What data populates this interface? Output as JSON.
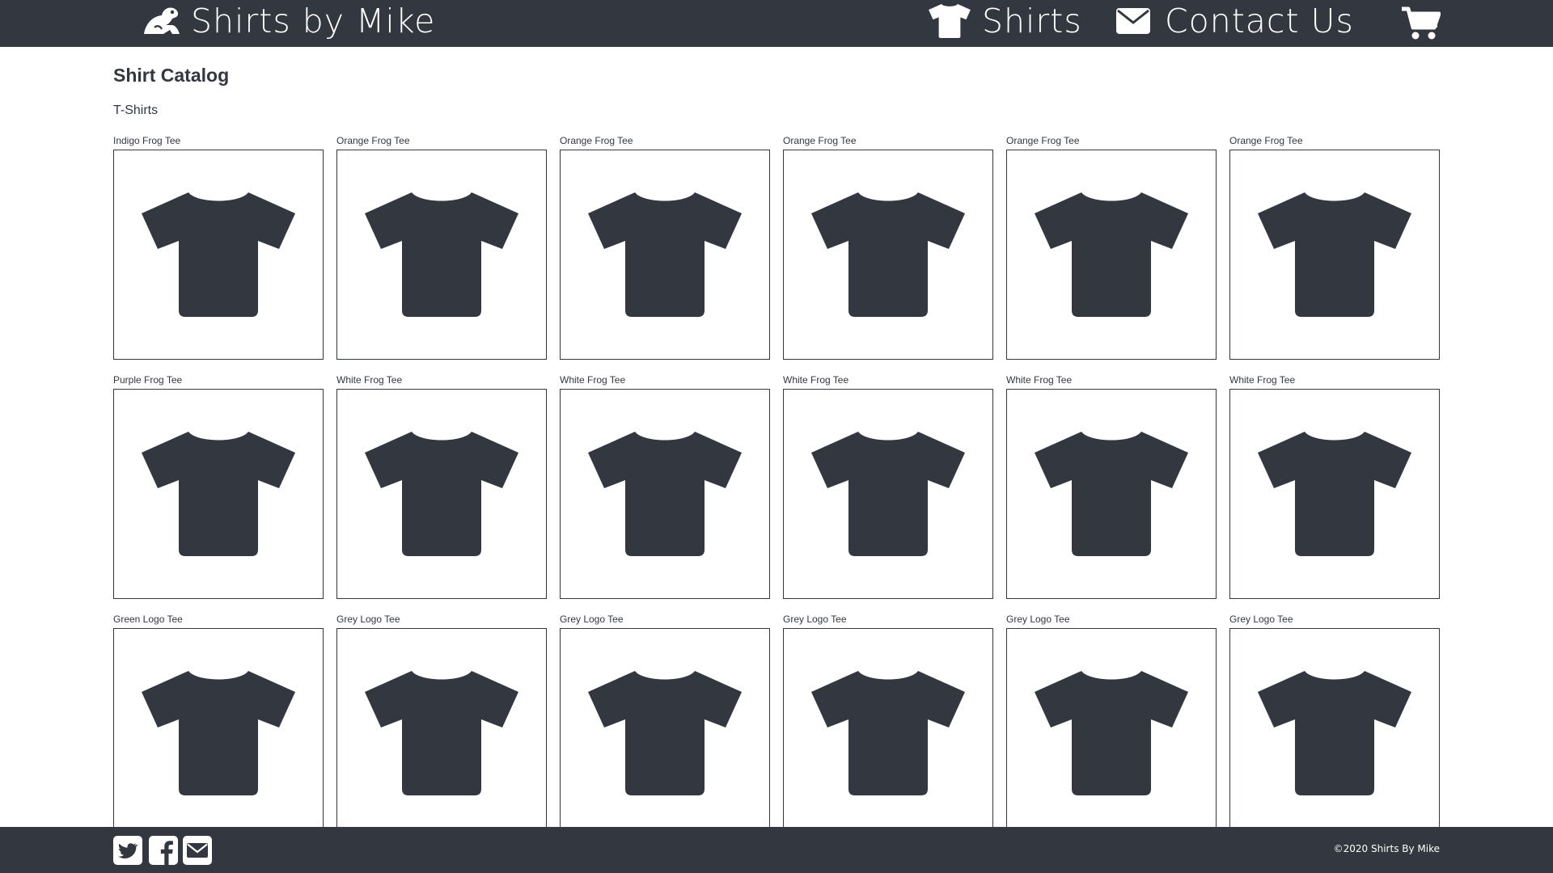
{
  "header": {
    "brand_name": "Shirts by Mike",
    "nav_shirts_label": "Shirts",
    "nav_contact_label": "Contact Us"
  },
  "main": {
    "title": "Shirt Catalog",
    "category": "T-Shirts",
    "products": [
      {
        "name": "Indigo Frog Tee"
      },
      {
        "name": "Orange Frog Tee"
      },
      {
        "name": "Orange Frog Tee"
      },
      {
        "name": "Orange Frog Tee"
      },
      {
        "name": "Orange Frog Tee"
      },
      {
        "name": "Orange Frog Tee"
      },
      {
        "name": "Purple Frog Tee"
      },
      {
        "name": "White Frog Tee"
      },
      {
        "name": "White Frog Tee"
      },
      {
        "name": "White Frog Tee"
      },
      {
        "name": "White Frog Tee"
      },
      {
        "name": "White Frog Tee"
      },
      {
        "name": "Green Logo Tee"
      },
      {
        "name": "Grey Logo Tee"
      },
      {
        "name": "Grey Logo Tee"
      },
      {
        "name": "Grey Logo Tee"
      },
      {
        "name": "Grey Logo Tee"
      },
      {
        "name": "Grey Logo Tee"
      }
    ]
  },
  "footer": {
    "copyright": "©2020 Shirts By Mike",
    "social_icons": [
      "twitter-icon",
      "facebook-icon",
      "email-icon"
    ]
  },
  "icons": {
    "brand": "frog-icon",
    "shirts": "tshirt-icon",
    "contact": "envelope-icon",
    "cart": "cart-icon",
    "product": "tshirt-icon"
  },
  "colors": {
    "dark": "#333740",
    "background": "#ffffff"
  }
}
